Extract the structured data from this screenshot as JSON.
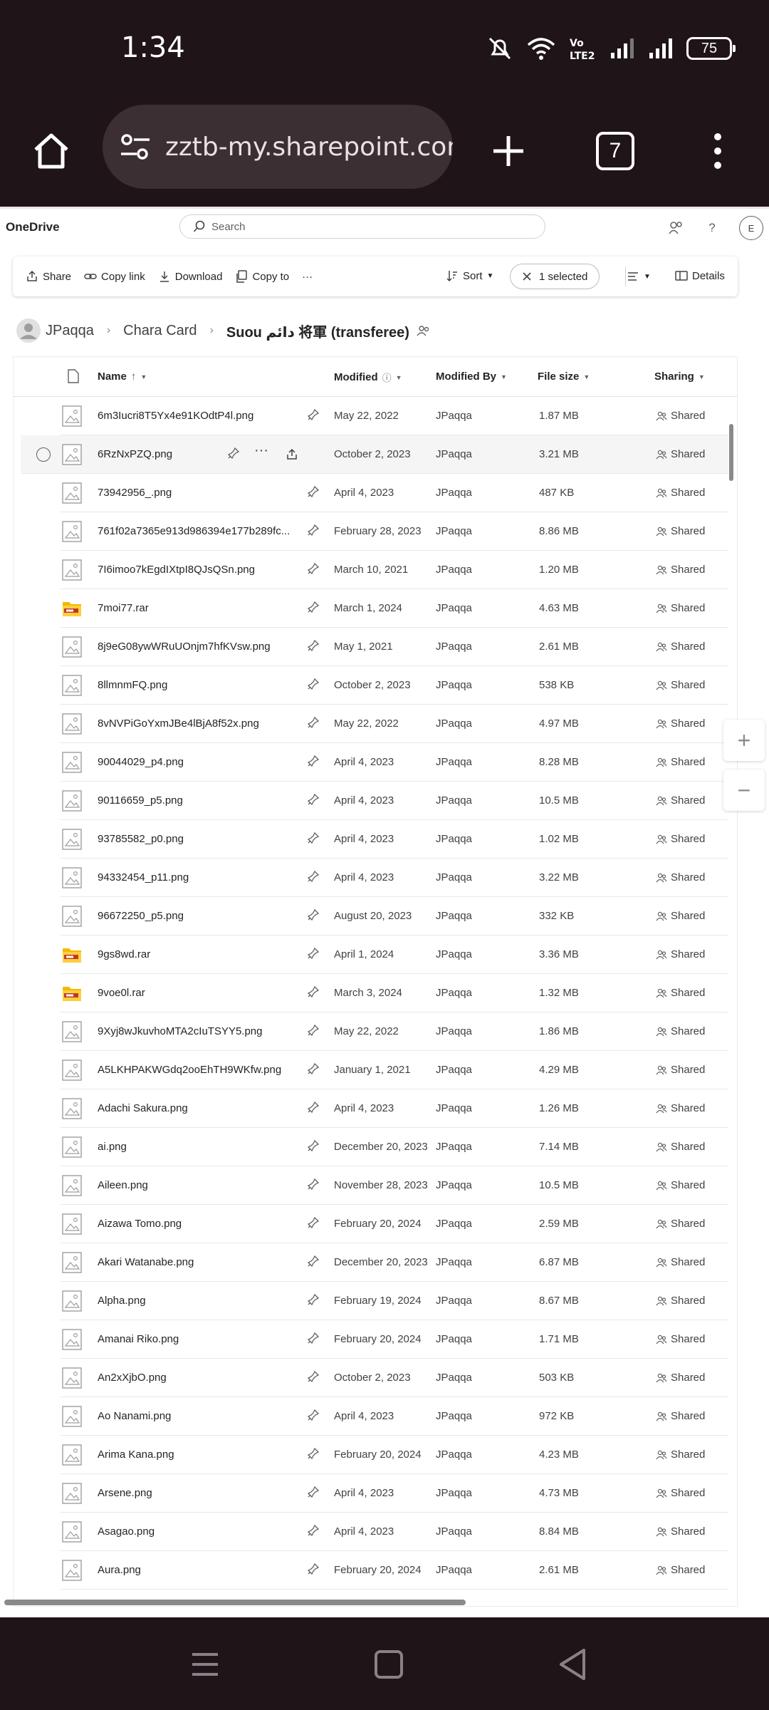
{
  "status": {
    "time": "1:34",
    "battery": "75"
  },
  "browser": {
    "url": "zztb-my.sharepoint.com/p",
    "tab_count": "7"
  },
  "app": {
    "name": "OneDrive",
    "search_placeholder": "Search",
    "avatar_initial": "E"
  },
  "commands": {
    "share": "Share",
    "copy_link": "Copy link",
    "download": "Download",
    "copy_to": "Copy to",
    "more": "···",
    "sort": "Sort",
    "selected": "1 selected",
    "details": "Details"
  },
  "breadcrumb": {
    "user": "JPaqqa",
    "folder1": "Chara Card",
    "folder2": "Suou دائم 将軍 (transferee)"
  },
  "columns": {
    "name": "Name",
    "modified": "Modified",
    "modified_by": "Modified By",
    "file_size": "File size",
    "sharing": "Sharing"
  },
  "rows": [
    {
      "name": "6m3Iucri8T5Yx4e91KOdtP4l.png",
      "modified": "May 22, 2022",
      "by": "JPaqqa",
      "size": "1.87 MB",
      "sharing": "Shared",
      "type": "image"
    },
    {
      "name": "6RzNxPZQ.png",
      "modified": "October 2, 2023",
      "by": "JPaqqa",
      "size": "3.21 MB",
      "sharing": "Shared",
      "type": "image",
      "selected": true
    },
    {
      "name": "73942956_.png",
      "modified": "April 4, 2023",
      "by": "JPaqqa",
      "size": "487 KB",
      "sharing": "Shared",
      "type": "image"
    },
    {
      "name": "761f02a7365e913d986394e177b289fc...",
      "modified": "February 28, 2023",
      "by": "JPaqqa",
      "size": "8.86 MB",
      "sharing": "Shared",
      "type": "image"
    },
    {
      "name": "7I6imoo7kEgdIXtpI8QJsQSn.png",
      "modified": "March 10, 2021",
      "by": "JPaqqa",
      "size": "1.20 MB",
      "sharing": "Shared",
      "type": "image"
    },
    {
      "name": "7moi77.rar",
      "modified": "March 1, 2024",
      "by": "JPaqqa",
      "size": "4.63 MB",
      "sharing": "Shared",
      "type": "archive"
    },
    {
      "name": "8j9eG08ywWRuUOnjm7hfKVsw.png",
      "modified": "May 1, 2021",
      "by": "JPaqqa",
      "size": "2.61 MB",
      "sharing": "Shared",
      "type": "image"
    },
    {
      "name": "8llmnmFQ.png",
      "modified": "October 2, 2023",
      "by": "JPaqqa",
      "size": "538 KB",
      "sharing": "Shared",
      "type": "image"
    },
    {
      "name": "8vNVPiGoYxmJBe4lBjA8f52x.png",
      "modified": "May 22, 2022",
      "by": "JPaqqa",
      "size": "4.97 MB",
      "sharing": "Shared",
      "type": "image"
    },
    {
      "name": "90044029_p4.png",
      "modified": "April 4, 2023",
      "by": "JPaqqa",
      "size": "8.28 MB",
      "sharing": "Shared",
      "type": "image"
    },
    {
      "name": "90116659_p5.png",
      "modified": "April 4, 2023",
      "by": "JPaqqa",
      "size": "10.5 MB",
      "sharing": "Shared",
      "type": "image"
    },
    {
      "name": "93785582_p0.png",
      "modified": "April 4, 2023",
      "by": "JPaqqa",
      "size": "1.02 MB",
      "sharing": "Shared",
      "type": "image"
    },
    {
      "name": "94332454_p11.png",
      "modified": "April 4, 2023",
      "by": "JPaqqa",
      "size": "3.22 MB",
      "sharing": "Shared",
      "type": "image"
    },
    {
      "name": "96672250_p5.png",
      "modified": "August 20, 2023",
      "by": "JPaqqa",
      "size": "332 KB",
      "sharing": "Shared",
      "type": "image"
    },
    {
      "name": "9gs8wd.rar",
      "modified": "April 1, 2024",
      "by": "JPaqqa",
      "size": "3.36 MB",
      "sharing": "Shared",
      "type": "archive"
    },
    {
      "name": "9voe0l.rar",
      "modified": "March 3, 2024",
      "by": "JPaqqa",
      "size": "1.32 MB",
      "sharing": "Shared",
      "type": "archive"
    },
    {
      "name": "9Xyj8wJkuvhoMTA2cIuTSYY5.png",
      "modified": "May 22, 2022",
      "by": "JPaqqa",
      "size": "1.86 MB",
      "sharing": "Shared",
      "type": "image"
    },
    {
      "name": "A5LKHPAKWGdq2ooEhTH9WKfw.png",
      "modified": "January 1, 2021",
      "by": "JPaqqa",
      "size": "4.29 MB",
      "sharing": "Shared",
      "type": "image"
    },
    {
      "name": "Adachi Sakura.png",
      "modified": "April 4, 2023",
      "by": "JPaqqa",
      "size": "1.26 MB",
      "sharing": "Shared",
      "type": "image"
    },
    {
      "name": "ai.png",
      "modified": "December 20, 2023",
      "by": "JPaqqa",
      "size": "7.14 MB",
      "sharing": "Shared",
      "type": "image"
    },
    {
      "name": "Aileen.png",
      "modified": "November 28, 2023",
      "by": "JPaqqa",
      "size": "10.5 MB",
      "sharing": "Shared",
      "type": "image"
    },
    {
      "name": "Aizawa Tomo.png",
      "modified": "February 20, 2024",
      "by": "JPaqqa",
      "size": "2.59 MB",
      "sharing": "Shared",
      "type": "image"
    },
    {
      "name": "Akari Watanabe.png",
      "modified": "December 20, 2023",
      "by": "JPaqqa",
      "size": "6.87 MB",
      "sharing": "Shared",
      "type": "image"
    },
    {
      "name": "Alpha.png",
      "modified": "February 19, 2024",
      "by": "JPaqqa",
      "size": "8.67 MB",
      "sharing": "Shared",
      "type": "image"
    },
    {
      "name": "Amanai Riko.png",
      "modified": "February 20, 2024",
      "by": "JPaqqa",
      "size": "1.71 MB",
      "sharing": "Shared",
      "type": "image"
    },
    {
      "name": "An2xXjbO.png",
      "modified": "October 2, 2023",
      "by": "JPaqqa",
      "size": "503 KB",
      "sharing": "Shared",
      "type": "image"
    },
    {
      "name": "Ao Nanami.png",
      "modified": "April 4, 2023",
      "by": "JPaqqa",
      "size": "972 KB",
      "sharing": "Shared",
      "type": "image"
    },
    {
      "name": "Arima Kana.png",
      "modified": "February 20, 2024",
      "by": "JPaqqa",
      "size": "4.23 MB",
      "sharing": "Shared",
      "type": "image"
    },
    {
      "name": "Arsene.png",
      "modified": "April 4, 2023",
      "by": "JPaqqa",
      "size": "4.73 MB",
      "sharing": "Shared",
      "type": "image"
    },
    {
      "name": "Asagao.png",
      "modified": "April 4, 2023",
      "by": "JPaqqa",
      "size": "8.84 MB",
      "sharing": "Shared",
      "type": "image"
    },
    {
      "name": "Aura.png",
      "modified": "February 20, 2024",
      "by": "JPaqqa",
      "size": "2.61 MB",
      "sharing": "Shared",
      "type": "image"
    }
  ]
}
